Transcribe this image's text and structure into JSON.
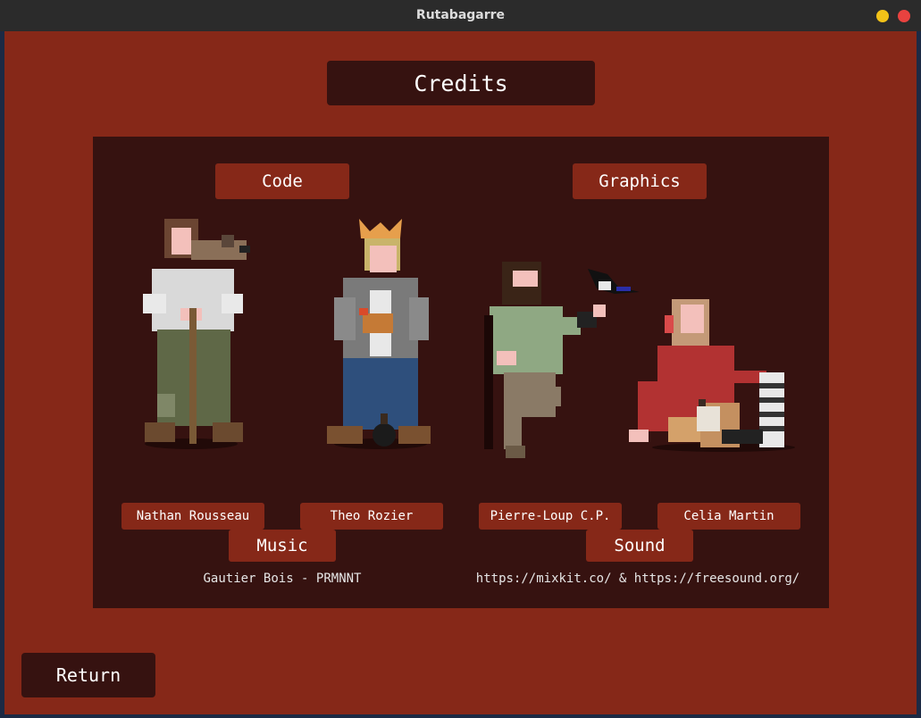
{
  "window": {
    "title": "Rutabagarre",
    "controls": {
      "minimize_color": "#f2c218",
      "close_color": "#e9423f"
    }
  },
  "colors": {
    "background": "#862818",
    "panel": "#361210",
    "label": "#862818",
    "text": "#ffffff"
  },
  "credits_title": "Credits",
  "sections": {
    "code": "Code",
    "graphics": "Graphics",
    "music": "Music",
    "sound": "Sound"
  },
  "people": [
    {
      "name": "Nathan Rousseau"
    },
    {
      "name": "Theo Rozier"
    },
    {
      "name": "Pierre-Loup C.P."
    },
    {
      "name": "Celia Martin"
    }
  ],
  "music_credit": "Gautier Bois - PRMNNT",
  "sound_credit": "https://mixkit.co/ & https://freesound.org/",
  "return_label": "Return"
}
